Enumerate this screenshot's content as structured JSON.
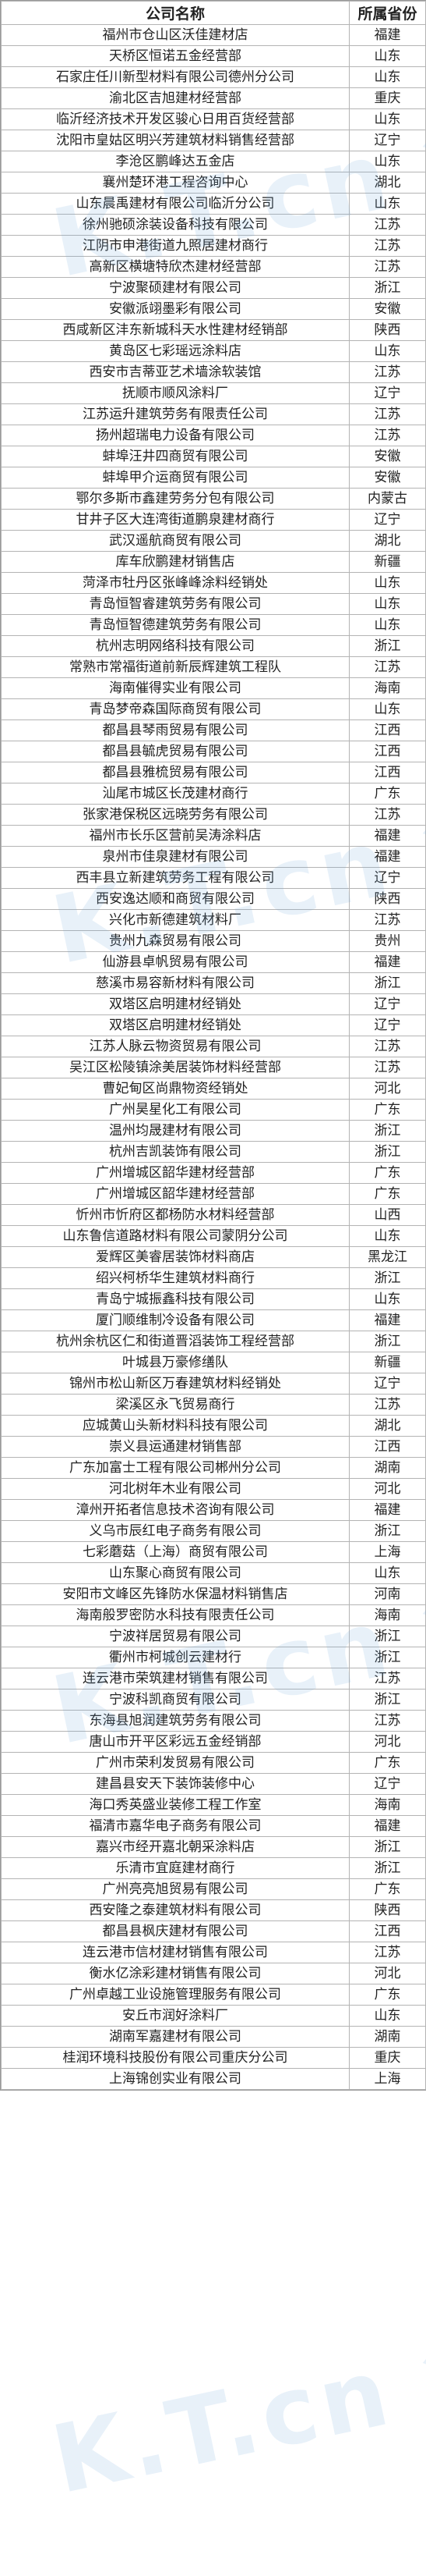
{
  "header": {
    "company_col": "公司名称",
    "province_col": "所属省份"
  },
  "rows": [
    [
      "福州市仓山区沃佳建材店",
      "福建"
    ],
    [
      "天桥区恒诺五金经营部",
      "山东"
    ],
    [
      "石家庄任川新型材料有限公司德州分公司",
      "山东"
    ],
    [
      "渝北区吉旭建材经营部",
      "重庆"
    ],
    [
      "临沂经济技术开发区骏心日用百货经营部",
      "山东"
    ],
    [
      "沈阳市皇姑区明兴芳建筑材料销售经营部",
      "辽宁"
    ],
    [
      "李沧区鹏峰达五金店",
      "山东"
    ],
    [
      "襄州楚环港工程咨询中心",
      "湖北"
    ],
    [
      "山东晨禹建材有限公司临沂分公司",
      "山东"
    ],
    [
      "徐州驰硕涂装设备科技有限公司",
      "江苏"
    ],
    [
      "江阴市申港街道九照居建材商行",
      "江苏"
    ],
    [
      "高新区横塘特欣杰建材经营部",
      "江苏"
    ],
    [
      "宁波聚硕建材有限公司",
      "浙江"
    ],
    [
      "安徽派翊墨彩有限公司",
      "安徽"
    ],
    [
      "西咸新区沣东新城科天水性建材经销部",
      "陕西"
    ],
    [
      "黄岛区七彩瑶远涂料店",
      "山东"
    ],
    [
      "西安市吉蒂亚艺术墙涂软装馆",
      "江苏"
    ],
    [
      "抚顺市顺风涂料厂",
      "辽宁"
    ],
    [
      "江苏运升建筑劳务有限责任公司",
      "江苏"
    ],
    [
      "扬州超瑞电力设备有限公司",
      "江苏"
    ],
    [
      "蚌埠汪井四商贸有限公司",
      "安徽"
    ],
    [
      "蚌埠甲介运商贸有限公司",
      "安徽"
    ],
    [
      "鄂尔多斯市鑫建劳务分包有限公司",
      "内蒙古"
    ],
    [
      "甘井子区大连湾街道鹏泉建材商行",
      "辽宁"
    ],
    [
      "武汉遥航商贸有限公司",
      "湖北"
    ],
    [
      "库车欣鹏建材销售店",
      "新疆"
    ],
    [
      "菏泽市牡丹区张峰峰涂料经销处",
      "山东"
    ],
    [
      "青岛恒智睿建筑劳务有限公司",
      "山东"
    ],
    [
      "青岛恒智德建筑劳务有限公司",
      "山东"
    ],
    [
      "杭州志明网络科技有限公司",
      "浙江"
    ],
    [
      "常熟市常福街道前新辰辉建筑工程队",
      "江苏"
    ],
    [
      "海南催得实业有限公司",
      "海南"
    ],
    [
      "青岛梦帝森国际商贸有限公司",
      "山东"
    ],
    [
      "都昌县琴雨贸易有限公司",
      "江西"
    ],
    [
      "都昌县毓虎贸易有限公司",
      "江西"
    ],
    [
      "都昌县雅梳贸易有限公司",
      "江西"
    ],
    [
      "汕尾市城区长茂建材商行",
      "广东"
    ],
    [
      "张家港保税区远晓劳务有限公司",
      "江苏"
    ],
    [
      "福州市长乐区营前吴涛涂料店",
      "福建"
    ],
    [
      "泉州市佳泉建材有限公司",
      "福建"
    ],
    [
      "西丰县立新建筑劳务工程有限公司",
      "辽宁"
    ],
    [
      "西安逸达顺和商贸有限公司",
      "陕西"
    ],
    [
      "兴化市新德建筑材料厂",
      "江苏"
    ],
    [
      "贵州九森贸易有限公司",
      "贵州"
    ],
    [
      "仙游县卓帆贸易有限公司",
      "福建"
    ],
    [
      "慈溪市易容新材料有限公司",
      "浙江"
    ],
    [
      "双塔区启明建材经销处",
      "辽宁"
    ],
    [
      "双塔区启明建材经销处",
      "辽宁"
    ],
    [
      "江苏人脉云物资贸易有限公司",
      "江苏"
    ],
    [
      "吴江区松陵镇涂美居装饰材料经营部",
      "江苏"
    ],
    [
      "曹妃甸区尚鼎物资经销处",
      "河北"
    ],
    [
      "广州昊星化工有限公司",
      "广东"
    ],
    [
      "温州均晟建材有限公司",
      "浙江"
    ],
    [
      "杭州吉凯装饰有限公司",
      "浙江"
    ],
    [
      "广州增城区韶华建材经营部",
      "广东"
    ],
    [
      "广州增城区韶华建材经营部",
      "广东"
    ],
    [
      "忻州市忻府区都杨防水材料经营部",
      "山西"
    ],
    [
      "山东鲁信道路材料有限公司蒙阴分公司",
      "山东"
    ],
    [
      "爱辉区美睿居装饰材料商店",
      "黑龙江"
    ],
    [
      "绍兴柯桥华生建筑材料商行",
      "浙江"
    ],
    [
      "青岛宁城振鑫科技有限公司",
      "山东"
    ],
    [
      "厦门顺维制冷设备有限公司",
      "福建"
    ],
    [
      "杭州余杭区仁和街道晋滔装饰工程经营部",
      "浙江"
    ],
    [
      "叶城县万豪修缮队",
      "新疆"
    ],
    [
      "锦州市松山新区万春建筑材料经销处",
      "辽宁"
    ],
    [
      "梁溪区永飞贸易商行",
      "江苏"
    ],
    [
      "应城黄山头新材料科技有限公司",
      "湖北"
    ],
    [
      "崇义县运通建材销售部",
      "江西"
    ],
    [
      "广东加富士工程有限公司郴州分公司",
      "湖南"
    ],
    [
      "河北树年木业有限公司",
      "河北"
    ],
    [
      "漳州开拓者信息技术咨询有限公司",
      "福建"
    ],
    [
      "义乌市辰红电子商务有限公司",
      "浙江"
    ],
    [
      "七彩蘑菇（上海）商贸有限公司",
      "上海"
    ],
    [
      "山东聚心商贸有限公司",
      "山东"
    ],
    [
      "安阳市文峰区先锋防水保温材料销售店",
      "河南"
    ],
    [
      "海南般罗密防水科技有限责任公司",
      "海南"
    ],
    [
      "宁波祥居贸易有限公司",
      "浙江"
    ],
    [
      "衢州市柯城创云建材行",
      "浙江"
    ],
    [
      "连云港市荣筑建材销售有限公司",
      "江苏"
    ],
    [
      "宁波科凯商贸有限公司",
      "浙江"
    ],
    [
      "东海县旭润建筑劳务有限公司",
      "江苏"
    ],
    [
      "唐山市开平区彩远五金经销部",
      "河北"
    ],
    [
      "广州市荣利发贸易有限公司",
      "广东"
    ],
    [
      "建昌县安天下装饰装修中心",
      "辽宁"
    ],
    [
      "海口秀英盛业装修工程工作室",
      "海南"
    ],
    [
      "福清市嘉华电子商务有限公司",
      "福建"
    ],
    [
      "嘉兴市经开嘉北朝采涂料店",
      "浙江"
    ],
    [
      "乐清市宜庭建材商行",
      "浙江"
    ],
    [
      "广州亮亮旭贸易有限公司",
      "广东"
    ],
    [
      "西安隆之泰建筑材料有限公司",
      "陕西"
    ],
    [
      "都昌县枫庆建材有限公司",
      "江西"
    ],
    [
      "连云港市信材建材销售有限公司",
      "江苏"
    ],
    [
      "衡水亿涂彩建材销售有限公司",
      "河北"
    ],
    [
      "广州卓越工业设施管理服务有限公司",
      "广东"
    ],
    [
      "安丘市润好涂料厂",
      "山东"
    ],
    [
      "湖南军嘉建材有限公司",
      "湖南"
    ],
    [
      "桂润环境科技股份有限公司重庆分公司",
      "重庆"
    ],
    [
      "上海锦创实业有限公司",
      "上海"
    ]
  ],
  "watermark": {
    "text": "K.T.cn 集采"
  }
}
